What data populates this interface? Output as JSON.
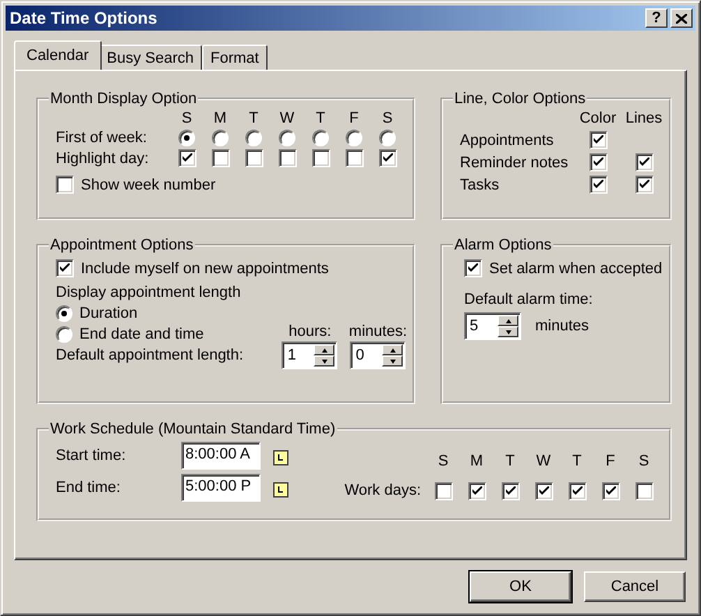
{
  "window": {
    "title": "Date Time Options",
    "help": "?"
  },
  "tabs": [
    {
      "label": "Calendar",
      "selected": true
    },
    {
      "label": "Busy Search",
      "selected": false
    },
    {
      "label": "Format",
      "selected": false
    }
  ],
  "month_display": {
    "title": "Month Display Option",
    "days": [
      "S",
      "M",
      "T",
      "W",
      "T",
      "F",
      "S"
    ],
    "first_of_week": {
      "label": "First of week:",
      "options": [
        {
          "selected": true
        },
        {
          "selected": false
        },
        {
          "selected": false
        },
        {
          "selected": false
        },
        {
          "selected": false
        },
        {
          "selected": false
        },
        {
          "selected": false
        }
      ]
    },
    "highlight_day": {
      "label": "Highlight day:",
      "options": [
        {
          "checked": true
        },
        {
          "checked": false
        },
        {
          "checked": false
        },
        {
          "checked": false
        },
        {
          "checked": false
        },
        {
          "checked": false
        },
        {
          "checked": true
        }
      ]
    },
    "show_week_number": {
      "label": "Show week number",
      "checked": false
    }
  },
  "line_color": {
    "title": "Line, Color Options",
    "columns": [
      "Color",
      "Lines"
    ],
    "rows": [
      {
        "label": "Appointments",
        "color_on": true
      },
      {
        "label": "Reminder notes",
        "color_on": true,
        "lines_on": true
      },
      {
        "label": "Tasks",
        "color_on": true,
        "lines_on": true
      }
    ]
  },
  "appointment": {
    "title": "Appointment Options",
    "include_myself": {
      "label": "Include myself on new appointments",
      "checked": true
    },
    "display_length_label": "Display appointment length",
    "length_modes": [
      {
        "label": "Duration",
        "selected": true
      },
      {
        "label": "End date and time",
        "selected": false
      }
    ],
    "default_length_label": "Default appointment length:",
    "hours": {
      "label": "hours:",
      "value": "1"
    },
    "minutes": {
      "label": "minutes:",
      "value": "0"
    }
  },
  "alarm": {
    "title": "Alarm Options",
    "set_alarm": {
      "label": "Set alarm when accepted",
      "checked": true
    },
    "default_time_label": "Default alarm time:",
    "default_time": {
      "value": "5",
      "unit": "minutes"
    }
  },
  "work_schedule": {
    "title": "Work Schedule (Mountain Standard Time)",
    "start": {
      "label": "Start time:",
      "value": "8:00:00 A"
    },
    "end": {
      "label": "End time:",
      "value": "5:00:00 P"
    },
    "days": [
      "S",
      "M",
      "T",
      "W",
      "T",
      "F",
      "S"
    ],
    "work_days_label": "Work days:",
    "work_days": [
      {
        "checked": false
      },
      {
        "checked": true
      },
      {
        "checked": true
      },
      {
        "checked": true
      },
      {
        "checked": true
      },
      {
        "checked": true
      },
      {
        "checked": false
      }
    ]
  },
  "buttons": [
    {
      "label": "OK",
      "default": true
    },
    {
      "label": "Cancel",
      "default": false
    }
  ]
}
